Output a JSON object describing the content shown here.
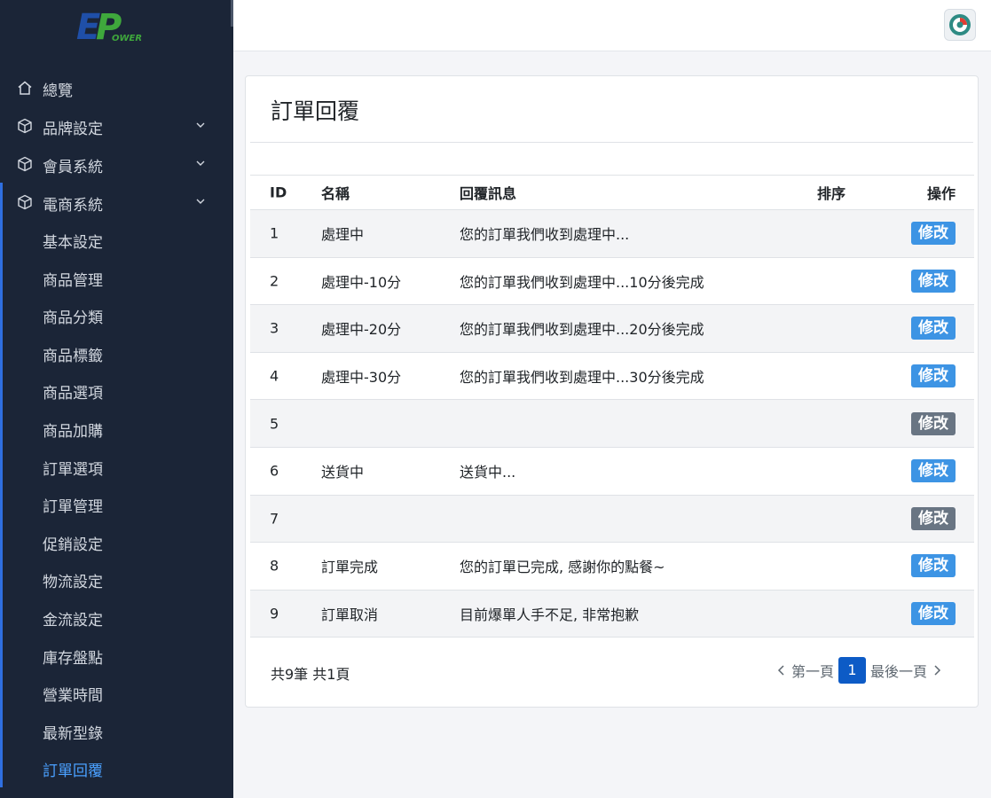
{
  "brand": {
    "logo_text": "EPower"
  },
  "sidebar": {
    "items": [
      {
        "label": "總覽",
        "icon": "home-icon",
        "expandable": false
      },
      {
        "label": "品牌設定",
        "icon": "box-icon",
        "expandable": true
      },
      {
        "label": "會員系統",
        "icon": "box-icon",
        "expandable": true
      },
      {
        "label": "電商系統",
        "icon": "box-icon",
        "expandable": true
      }
    ],
    "sub_items": [
      {
        "label": "基本設定"
      },
      {
        "label": "商品管理"
      },
      {
        "label": "商品分類"
      },
      {
        "label": "商品標籤"
      },
      {
        "label": "商品選項"
      },
      {
        "label": "商品加購"
      },
      {
        "label": "訂單選項"
      },
      {
        "label": "訂單管理"
      },
      {
        "label": "促銷設定"
      },
      {
        "label": "物流設定"
      },
      {
        "label": "金流設定"
      },
      {
        "label": "庫存盤點"
      },
      {
        "label": "營業時間"
      },
      {
        "label": "最新型錄"
      },
      {
        "label": "訂單回覆",
        "active": true
      }
    ]
  },
  "page": {
    "title": "訂單回覆"
  },
  "table": {
    "headers": {
      "id": "ID",
      "name": "名稱",
      "message": "回覆訊息",
      "sort": "排序",
      "action": "操作"
    },
    "rows": [
      {
        "id": "1",
        "name": "處理中",
        "message": "您的訂單我們收到處理中...",
        "sort": "",
        "action": "修改",
        "status": "active"
      },
      {
        "id": "2",
        "name": "處理中-10分",
        "message": "您的訂單我們收到處理中...10分後完成",
        "sort": "",
        "action": "修改",
        "status": "active"
      },
      {
        "id": "3",
        "name": "處理中-20分",
        "message": "您的訂單我們收到處理中...20分後完成",
        "sort": "",
        "action": "修改",
        "status": "active"
      },
      {
        "id": "4",
        "name": "處理中-30分",
        "message": "您的訂單我們收到處理中...30分後完成",
        "sort": "",
        "action": "修改",
        "status": "active"
      },
      {
        "id": "5",
        "name": "",
        "message": "",
        "sort": "",
        "action": "修改",
        "status": "inactive"
      },
      {
        "id": "6",
        "name": "送貨中",
        "message": "送貨中...",
        "sort": "",
        "action": "修改",
        "status": "active"
      },
      {
        "id": "7",
        "name": "",
        "message": "",
        "sort": "",
        "action": "修改",
        "status": "inactive"
      },
      {
        "id": "8",
        "name": "訂單完成",
        "message": "您的訂單已完成, 感謝你的點餐~",
        "sort": "",
        "action": "修改",
        "status": "active"
      },
      {
        "id": "9",
        "name": "訂單取消",
        "message": "目前爆單人手不足, 非常抱歉",
        "sort": "",
        "action": "修改",
        "status": "active"
      }
    ]
  },
  "footer": {
    "count_text": "共9筆 共1頁"
  },
  "pagination": {
    "first_label": "第一頁",
    "current_page": "1",
    "last_label": "最後一頁"
  },
  "colors": {
    "sidebar_bg": "#1b2537",
    "accent": "#3d94e4",
    "inactive_button": "#697583",
    "active_nav": "#4aa0ff",
    "page_active": "#0d5bc6"
  }
}
